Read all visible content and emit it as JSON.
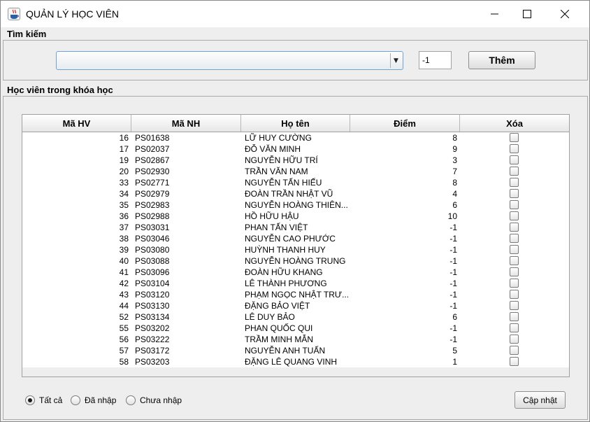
{
  "window": {
    "title": "QUẢN LÝ HỌC VIÊN"
  },
  "search": {
    "section_label": "Tìm kiếm",
    "combo_value": "",
    "number_value": "-1",
    "add_label": "Thêm"
  },
  "students": {
    "section_label": "Học viên trong khóa học",
    "columns": [
      "Mã HV",
      "Mã NH",
      "Họ tên",
      "Điểm",
      "Xóa"
    ],
    "rows": [
      {
        "id": "16",
        "nh": "PS01638",
        "name": "LỮ HUY CƯỜNG",
        "score": "8",
        "delete": false
      },
      {
        "id": "17",
        "nh": "PS02037",
        "name": "ĐỖ VĂN MINH",
        "score": "9",
        "delete": false
      },
      {
        "id": "19",
        "nh": "PS02867",
        "name": "NGUYỄN HỮU TRÍ",
        "score": "3",
        "delete": false
      },
      {
        "id": "20",
        "nh": "PS02930",
        "name": "TRẦN VĂN NAM",
        "score": "7",
        "delete": false
      },
      {
        "id": "33",
        "nh": "PS02771",
        "name": "NGUYỄN TẤN HIẾU",
        "score": "8",
        "delete": false
      },
      {
        "id": "34",
        "nh": "PS02979",
        "name": "ĐOÀN TRẦN NHẬT VŨ",
        "score": "4",
        "delete": false
      },
      {
        "id": "35",
        "nh": "PS02983",
        "name": "NGUYỄN HOÀNG THIÊN...",
        "score": "6",
        "delete": false
      },
      {
        "id": "36",
        "nh": "PS02988",
        "name": "HỒ HỮU HẬU",
        "score": "10",
        "delete": false
      },
      {
        "id": "37",
        "nh": "PS03031",
        "name": "PHAN TẤN VIỆT",
        "score": "-1",
        "delete": false
      },
      {
        "id": "38",
        "nh": "PS03046",
        "name": "NGUYỄN CAO PHƯỚC",
        "score": "-1",
        "delete": false
      },
      {
        "id": "39",
        "nh": "PS03080",
        "name": "HUỲNH THANH HUY",
        "score": "-1",
        "delete": false
      },
      {
        "id": "40",
        "nh": "PS03088",
        "name": "NGUYỄN HOÀNG TRUNG",
        "score": "-1",
        "delete": false
      },
      {
        "id": "41",
        "nh": "PS03096",
        "name": "ĐOÀN HỮU KHANG",
        "score": "-1",
        "delete": false
      },
      {
        "id": "42",
        "nh": "PS03104",
        "name": "LÊ THÀNH PHƯƠNG",
        "score": "-1",
        "delete": false
      },
      {
        "id": "43",
        "nh": "PS03120",
        "name": "PHẠM NGỌC NHẬT TRƯ...",
        "score": "-1",
        "delete": false
      },
      {
        "id": "44",
        "nh": "PS03130",
        "name": "ĐẶNG BẢO VIỆT",
        "score": "-1",
        "delete": false
      },
      {
        "id": "52",
        "nh": "PS03134",
        "name": "LÊ DUY BẢO",
        "score": "6",
        "delete": false
      },
      {
        "id": "55",
        "nh": "PS03202",
        "name": "PHAN QUỐC QUI",
        "score": "-1",
        "delete": false
      },
      {
        "id": "56",
        "nh": "PS03222",
        "name": "TRẦM MINH MẪN",
        "score": "-1",
        "delete": false
      },
      {
        "id": "57",
        "nh": "PS03172",
        "name": "NGUYỄN ANH TUẤN",
        "score": "5",
        "delete": false
      },
      {
        "id": "58",
        "nh": "PS03203",
        "name": "ĐẶNG LÊ QUANG VINH",
        "score": "1",
        "delete": false
      }
    ]
  },
  "filter": {
    "options": [
      {
        "label": "Tất cả",
        "selected": true
      },
      {
        "label": "Đã nhập",
        "selected": false
      },
      {
        "label": "Chưa nhập",
        "selected": false
      }
    ],
    "update_label": "Cập nhật"
  },
  "icons": {
    "app": "java-coffee-cup-icon",
    "minimize": "minimize-icon",
    "maximize": "maximize-icon",
    "close": "close-icon",
    "dropdown": "chevron-down-icon"
  }
}
